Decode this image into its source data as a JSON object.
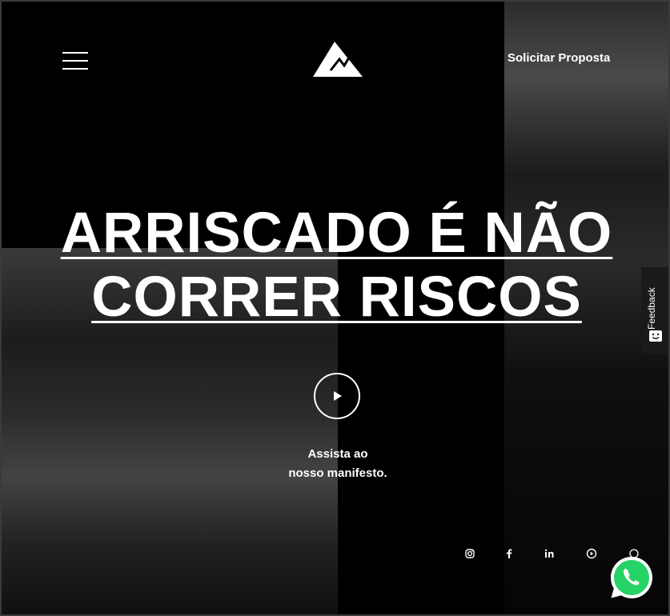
{
  "header": {
    "menu_icon": "hamburger-icon",
    "logo_icon": "mountain-logo-icon",
    "cta_label": "Solicitar Proposta"
  },
  "hero": {
    "title_line1": "ARRISCADO É NÃO",
    "title_line2": "CORRER RISCOS",
    "play_icon": "play-icon",
    "watch_line1": "Assista ao",
    "watch_line2": "nosso manifesto."
  },
  "social": {
    "icons": [
      "instagram-icon",
      "facebook-icon",
      "linkedin-icon",
      "youtube-icon",
      "whatsapp-icon"
    ]
  },
  "feedback": {
    "label": "Feedback"
  },
  "colors": {
    "background": "#000000",
    "text": "#ffffff",
    "whatsapp_green": "#25D366"
  }
}
